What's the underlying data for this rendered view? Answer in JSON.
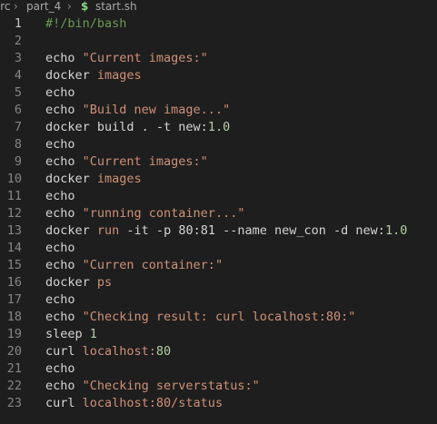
{
  "breadcrumb": {
    "items": [
      "src",
      "part_4",
      "start.sh"
    ],
    "file_icon": "dollar-sign-icon"
  },
  "colors": {
    "background": "#1e1e1e",
    "plain": "#d4d4d4",
    "string": "#ce9178",
    "comment": "#6a9955",
    "number": "#b5cea8",
    "line_number": "#858585"
  },
  "code": {
    "lines": [
      {
        "n": "1",
        "tokens": [
          {
            "t": "#!/bin/bash",
            "k": "comment"
          }
        ]
      },
      {
        "n": "2",
        "tokens": []
      },
      {
        "n": "3",
        "tokens": [
          {
            "t": "echo ",
            "k": "plain"
          },
          {
            "t": "\"Current images:\"",
            "k": "str"
          }
        ]
      },
      {
        "n": "4",
        "tokens": [
          {
            "t": "docker ",
            "k": "plain"
          },
          {
            "t": "images",
            "k": "str"
          }
        ]
      },
      {
        "n": "5",
        "tokens": [
          {
            "t": "echo",
            "k": "plain"
          }
        ]
      },
      {
        "n": "6",
        "tokens": [
          {
            "t": "echo ",
            "k": "plain"
          },
          {
            "t": "\"Build new image...\"",
            "k": "str"
          }
        ]
      },
      {
        "n": "7",
        "tokens": [
          {
            "t": "docker build . -t new:",
            "k": "plain"
          },
          {
            "t": "1.0",
            "k": "num"
          }
        ]
      },
      {
        "n": "8",
        "tokens": [
          {
            "t": "echo",
            "k": "plain"
          }
        ]
      },
      {
        "n": "9",
        "tokens": [
          {
            "t": "echo ",
            "k": "plain"
          },
          {
            "t": "\"Current images:\"",
            "k": "str"
          }
        ]
      },
      {
        "n": "10",
        "tokens": [
          {
            "t": "docker ",
            "k": "plain"
          },
          {
            "t": "images",
            "k": "str"
          }
        ]
      },
      {
        "n": "11",
        "tokens": [
          {
            "t": "echo",
            "k": "plain"
          }
        ]
      },
      {
        "n": "12",
        "tokens": [
          {
            "t": "echo ",
            "k": "plain"
          },
          {
            "t": "\"running container...\"",
            "k": "str"
          }
        ]
      },
      {
        "n": "13",
        "tokens": [
          {
            "t": "docker ",
            "k": "plain"
          },
          {
            "t": "run",
            "k": "str"
          },
          {
            "t": " -it -p ",
            "k": "plain"
          },
          {
            "t": "80:81",
            "k": "plain"
          },
          {
            "t": " --name ",
            "k": "plain"
          },
          {
            "t": "new_con",
            "k": "plain"
          },
          {
            "t": " -d new:",
            "k": "plain"
          },
          {
            "t": "1.0",
            "k": "num"
          }
        ]
      },
      {
        "n": "14",
        "tokens": [
          {
            "t": "echo",
            "k": "plain"
          }
        ]
      },
      {
        "n": "15",
        "tokens": [
          {
            "t": "echo ",
            "k": "plain"
          },
          {
            "t": "\"Curren container:\"",
            "k": "str"
          }
        ]
      },
      {
        "n": "16",
        "tokens": [
          {
            "t": "docker ",
            "k": "plain"
          },
          {
            "t": "ps",
            "k": "str"
          }
        ]
      },
      {
        "n": "17",
        "tokens": [
          {
            "t": "echo",
            "k": "plain"
          }
        ]
      },
      {
        "n": "18",
        "tokens": [
          {
            "t": "echo ",
            "k": "plain"
          },
          {
            "t": "\"Checking result: curl localhost:80:\"",
            "k": "str"
          }
        ]
      },
      {
        "n": "19",
        "tokens": [
          {
            "t": "sleep ",
            "k": "plain"
          },
          {
            "t": "1",
            "k": "num"
          }
        ]
      },
      {
        "n": "20",
        "tokens": [
          {
            "t": "curl ",
            "k": "plain"
          },
          {
            "t": "localhost:",
            "k": "str"
          },
          {
            "t": "80",
            "k": "num"
          }
        ]
      },
      {
        "n": "21",
        "tokens": [
          {
            "t": "echo",
            "k": "plain"
          }
        ]
      },
      {
        "n": "22",
        "tokens": [
          {
            "t": "echo ",
            "k": "plain"
          },
          {
            "t": "\"Checking serverstatus:\"",
            "k": "str"
          }
        ]
      },
      {
        "n": "23",
        "tokens": [
          {
            "t": "curl ",
            "k": "plain"
          },
          {
            "t": "localhost:80/status",
            "k": "str"
          }
        ]
      }
    ]
  }
}
